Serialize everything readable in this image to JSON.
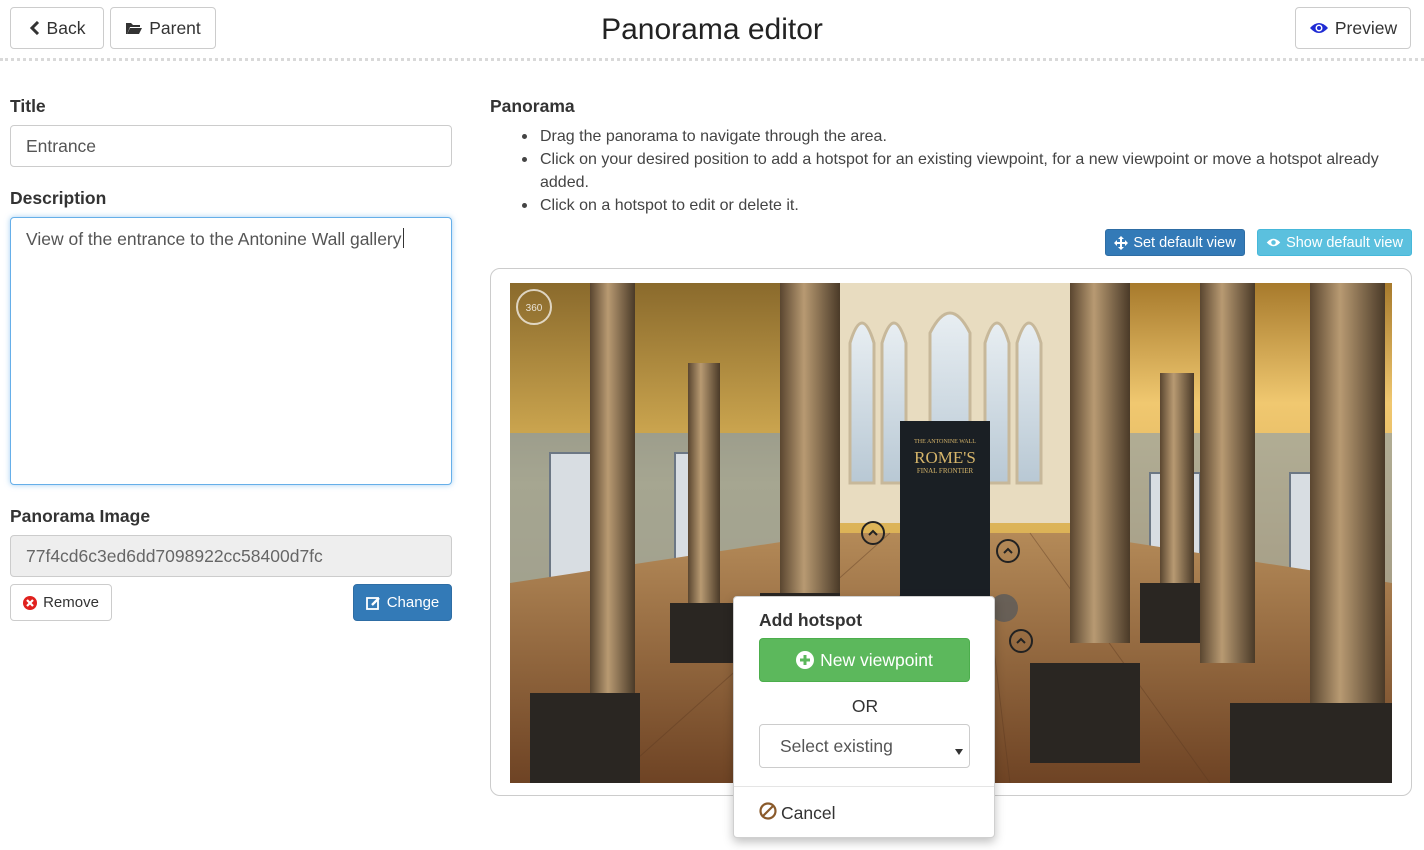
{
  "header": {
    "title": "Panorama editor",
    "back_label": "Back",
    "parent_label": "Parent",
    "preview_label": "Preview"
  },
  "form": {
    "title_label": "Title",
    "title_value": "Entrance",
    "description_label": "Description",
    "description_value": "View of the entrance to the Antonine Wall gallery",
    "image_label": "Panorama Image",
    "image_value": "77f4cd6c3ed6dd7098922cc58400d7fc",
    "remove_label": "Remove",
    "change_label": "Change"
  },
  "panorama": {
    "heading": "Panorama",
    "instructions": [
      "Drag the panorama to navigate through the area.",
      "Click on your desired position to add a hotspot for an existing viewpoint, for a new viewpoint or move a hotspot already",
      "added.",
      "Click on a hotspot to edit or delete it."
    ],
    "set_default_label": "Set default view",
    "show_default_label": "Show default view",
    "badge_360": "360",
    "sign_top": "THE ANTONINE WALL",
    "sign_main": "ROME'S",
    "sign_sub": "FINAL FRONTIER"
  },
  "hotspot_popup": {
    "title": "Add hotspot",
    "new_label": "New viewpoint",
    "or_label": "OR",
    "select_placeholder": "Select existing",
    "cancel_label": "Cancel"
  },
  "colors": {
    "primary": "#337ab7",
    "info": "#5bc0de",
    "success": "#5cb85c",
    "danger": "#d9534f"
  }
}
